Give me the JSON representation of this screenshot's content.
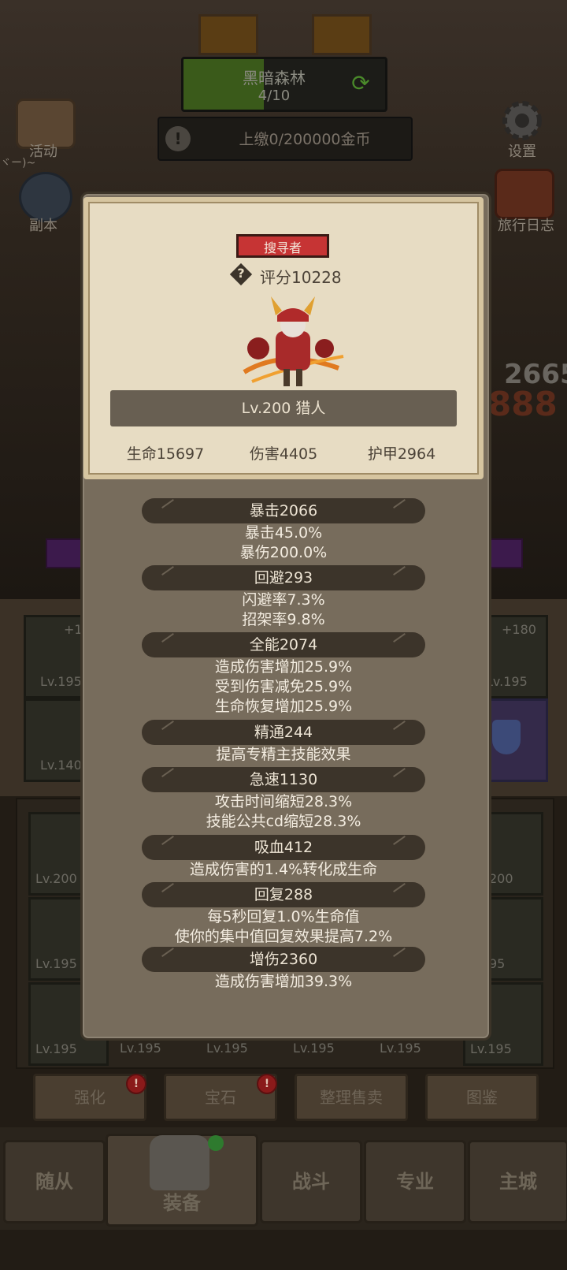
{
  "background": {
    "stage_name": "黑暗森林",
    "stage_progress": "4/10",
    "stage_progress_fraction": 0.4,
    "tribute_text": "上缴0/200000金币",
    "tribute_icon": "!",
    "left_menu": [
      {
        "label": "活动",
        "icon": "scroll-icon"
      },
      {
        "label": "副本",
        "icon": "portal-icon"
      }
    ],
    "left_fragment": "ヾー)~",
    "right_menu": [
      {
        "label": "设置",
        "icon": "gear-icon"
      },
      {
        "label": "旅行日志",
        "icon": "journal-icon"
      }
    ],
    "damage_numbers": [
      "2665",
      "888"
    ],
    "equip_top_levels": [
      "Lv.195",
      "Lv.195",
      "Lv.140"
    ],
    "equip_top_bonus": [
      "+1",
      "+180"
    ],
    "equip_grid_levels": [
      "Lv.200",
      "Lv.195",
      "Lv.195",
      "Lv.195",
      "Lv.195",
      "Lv.195",
      "Lv.195",
      "Lv.195",
      "200",
      "95"
    ],
    "action_buttons": [
      {
        "label": "强化",
        "alert": true
      },
      {
        "label": "宝石",
        "alert": true
      },
      {
        "label": "整理售卖",
        "alert": false
      },
      {
        "label": "图鉴",
        "alert": false
      }
    ],
    "alert_symbol": "!",
    "nav_tabs": [
      "随从",
      "装备",
      "战斗",
      "专业",
      "主城"
    ],
    "active_tab": "装备"
  },
  "hero": {
    "role": "搜寻者",
    "score_label": "评分10228",
    "score_help_icon": "?",
    "name_level": "Lv.200 猎人",
    "hp": "生命15697",
    "damage": "伤害4405",
    "armor": "护甲2964"
  },
  "stats": [
    {
      "header": "暴击2066",
      "lines": [
        "暴击45.0%",
        "暴伤200.0%"
      ]
    },
    {
      "header": "回避293",
      "lines": [
        "闪避率7.3%",
        "招架率9.8%"
      ]
    },
    {
      "header": "全能2074",
      "lines": [
        "造成伤害增加25.9%",
        "受到伤害减免25.9%",
        "生命恢复增加25.9%"
      ]
    },
    {
      "header": "精通244",
      "lines": [
        "提高专精主技能效果"
      ]
    },
    {
      "header": "急速1130",
      "lines": [
        "攻击时间缩短28.3%",
        "技能公共cd缩短28.3%"
      ]
    },
    {
      "header": "吸血412",
      "lines": [
        "造成伤害的1.4%转化成生命"
      ]
    },
    {
      "header": "回复288",
      "lines": [
        "每5秒回复1.0%生命值",
        "使你的集中值回复效果提高7.2%"
      ]
    },
    {
      "header": "增伤2360",
      "lines": [
        "造成伤害增加39.3%"
      ]
    }
  ],
  "colors": {
    "role_badge": "#c63434",
    "card_bg": "#e7dcc3",
    "modal_bg": "#776c5c",
    "stat_header": "#3c342a"
  }
}
